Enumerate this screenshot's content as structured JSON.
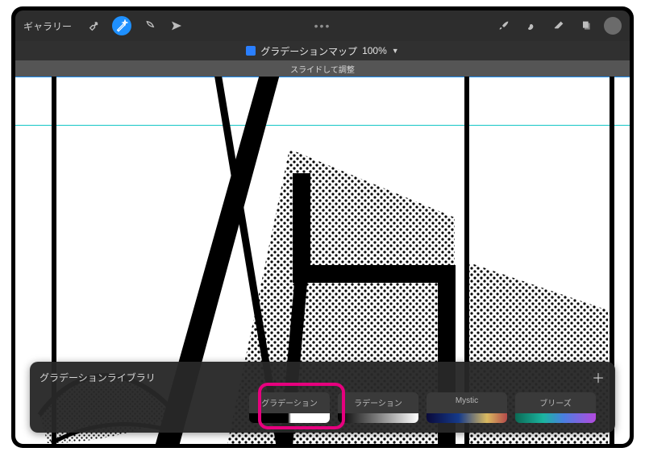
{
  "topbar": {
    "gallery_label": "ギャラリー",
    "ellipsis": "•••"
  },
  "title": {
    "label": "グラデーションマップ",
    "percent": "100%",
    "chevron": "▼"
  },
  "hint": "スライドして調整",
  "panel": {
    "title": "グラデーションライブラリ",
    "plus": "＋",
    "swatches": [
      {
        "label": "グラデーション",
        "grad": "grad-bw"
      },
      {
        "label": "ラデーション",
        "grad": "grad-bw2"
      },
      {
        "label": "Mystic",
        "grad": "grad-mystic"
      },
      {
        "label": "ブリーズ",
        "grad": "grad-breeze"
      }
    ]
  }
}
